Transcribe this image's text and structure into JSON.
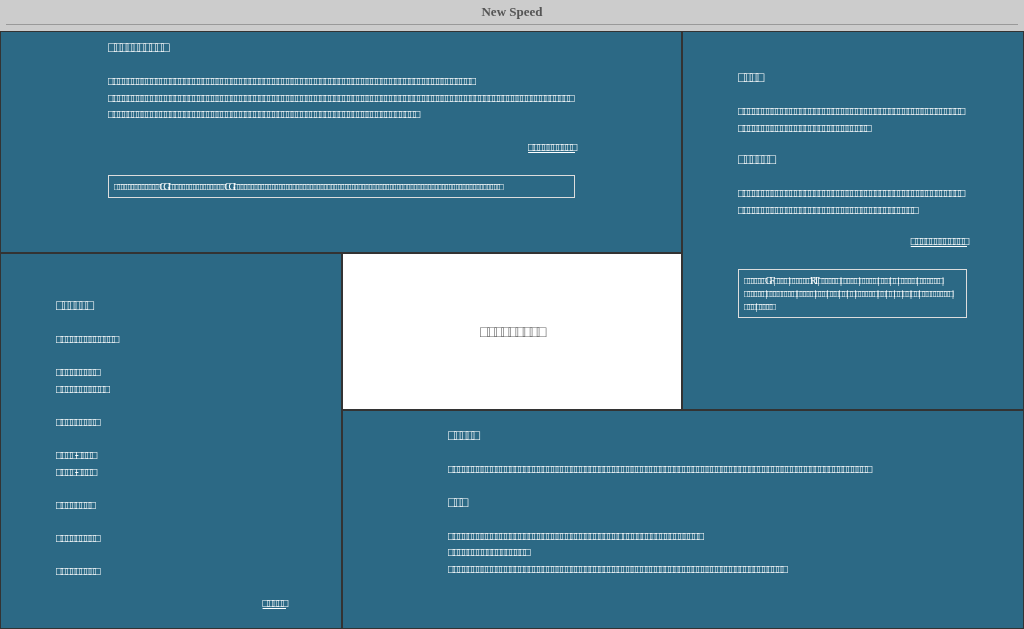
{
  "title": "New Speed",
  "intro": {
    "heading": "□□□□□□□□□□",
    "paragraphs": [
      "□□□□□□□□□□□□□□□□□□□□□□□□□□□□□□□□□□□□□□□□□□□□□□□□□□□□□□□□□□□□□□□□□□□□□□□□□□□□□□",
      "□□□□□□□□□□□□□□□□□□□□□□□□□□□□□□□□□□□□□□□□□□□□□□□□□□□□□□□□□□□□□□□□□□□□□□□□□□□□□□□□□□□□□□□□□□□□□□□□□□□□□□□□□□□□□□□□□□□□□□□□□□□□□□□□□□□□□□□□□□□□□□□□□□□□□□□□□□□□□□□□ □□□□□"
    ],
    "link": "□□□□□□□□□□",
    "notice": "□□□□□ □□□□□□□□CGI □□□□□□□□ □□□□□□□□CGI □□□□□□□□□□□□ □□□□□□□□□□□ □□□□□□□□□ □□□□□□ □□□□□ □□ □□□□ □□□□□ □□□□□ □□□□□ □□□□□ □□□ □□□□□"
  },
  "side": {
    "sections": [
      {
        "heading": "□□□□",
        "text": "□□□□□□□□□□□□□□□□□□□□□□□□□□□□□□□□□□□□□□□□□□□□□□□□□□□□□□□□□□□□□□□□□□□□□□□□□□□□"
      },
      {
        "heading": "□□□□□□",
        "text": "□□□□□□□□□□□□□□□□□□□□□□□□□□□□□□□□□□□□□□□□□□□□□□□□□□□□□□□□□□□□□□□□□□□□□□□□□□□□□□□□□□□□□□"
      }
    ],
    "link": "□□□□□□□□□□□□",
    "tags": "□□□□□□GF | □□□□ | □□□□□□RT | □□□□□□ | □□□□□ | □□□□□ | □□□ | □□ | □□□□□ | □□□□□□□ | □□□□□□ | □□□□ □□□□ | □□□□□ | □□□ | □□□ | □□ | □□ | □□□□□□ | □□ | □□ | □□ | □□ | □□ | □□□ □□□□□□ | □□□ | □□□□□"
  },
  "menu": {
    "heading": "□□□□□□",
    "groups": [
      [
        "□□□□□□□□□□□□□"
      ],
      [
        "□□□□□□□□□",
        "□□□□□□□□□□□"
      ],
      [
        "□□□□□□□□□"
      ],
      [
        "□□□□-□□□□",
        "□□□□-□□□□"
      ],
      [
        "□□□□□□□□"
      ],
      [
        "□□□□□□□□□"
      ],
      [
        "□□□□□□□□□"
      ]
    ],
    "link": "□□□□□"
  },
  "banner": {
    "text": "□□□□□□□□□"
  },
  "news": {
    "sections": [
      {
        "heading": "□□□□□",
        "lines": [
          "□□□□□□□□□□□□□□□□□□□□□□□□□□□□□□□□□□□□□□□□□□□□□□□□□□□□□□□□□□□□□□□□□□□□□□□□□□□□□□□□□□□□□□□□□□"
        ]
      },
      {
        "heading": "□□□",
        "lines": [
          "□□□□□□□□□□□□□□□□□□□□□□□□□□□□□□□□□□□□□ □□□□□□□□□□□□□□□□□",
          "□□□□□□    □□□□□□□□□□□",
          "□□□□□□□□□□□□□□□□□□□□□□□□□□□□□□□□□□□□□□□□□□□□□□□□□□□□□□□□□□□□□□□□□□□□□□□□"
        ]
      }
    ]
  }
}
